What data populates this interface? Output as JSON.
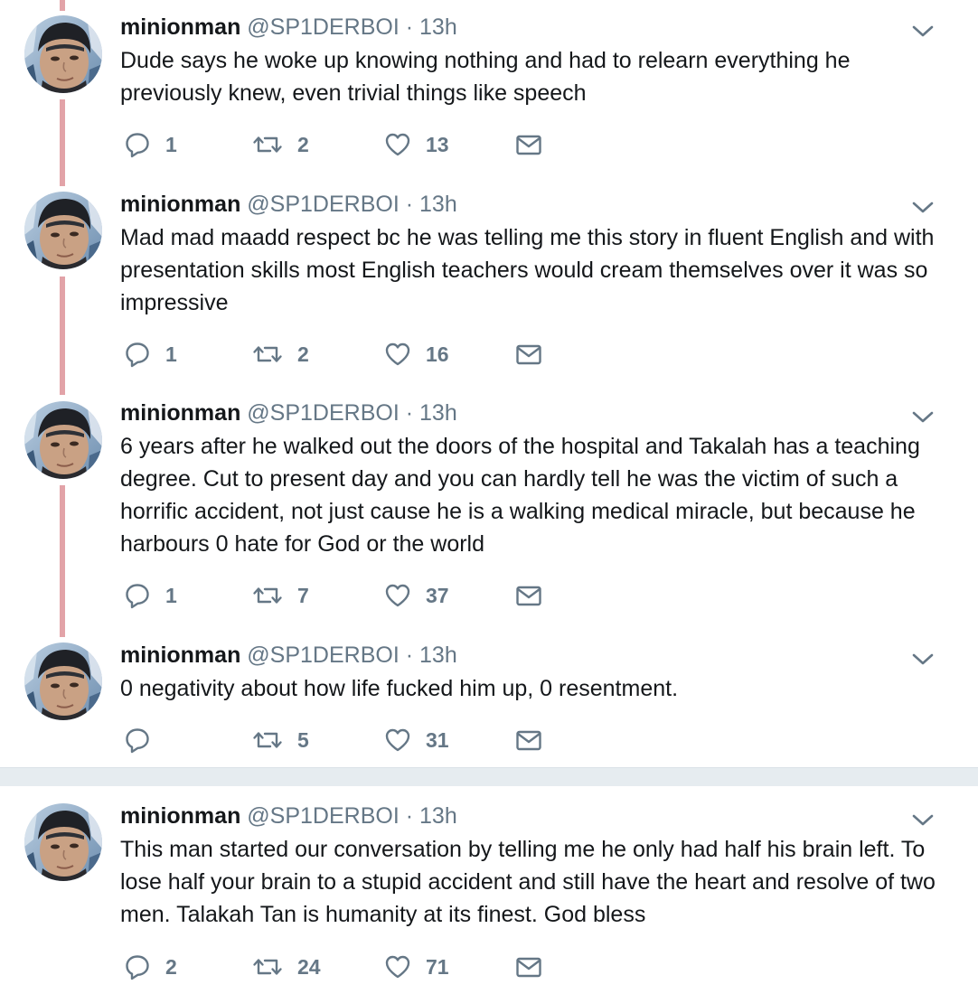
{
  "tweets": [
    {
      "name": "minionman",
      "handle": "@SP1DERBOI",
      "dot": "·",
      "time": "13h",
      "text": "Dude says he woke up knowing nothing and had to relearn everything he previously knew, even trivial things like speech",
      "replies": "1",
      "retweets": "2",
      "likes": "13"
    },
    {
      "name": "minionman",
      "handle": "@SP1DERBOI",
      "dot": "·",
      "time": "13h",
      "text": "Mad mad maadd respect bc he was telling me this story in fluent English and with presentation skills most English teachers would cream themselves over it was so impressive",
      "replies": "1",
      "retweets": "2",
      "likes": "16"
    },
    {
      "name": "minionman",
      "handle": "@SP1DERBOI",
      "dot": "·",
      "time": "13h",
      "text": "6 years after he walked out the doors of the hospital and Takalah has a teaching degree. Cut to present day and you can hardly tell he was the victim of such a horrific accident, not just cause he is a walking medical miracle, but because he harbours 0 hate for God or the world",
      "replies": "1",
      "retweets": "7",
      "likes": "37"
    },
    {
      "name": "minionman",
      "handle": "@SP1DERBOI",
      "dot": "·",
      "time": "13h",
      "text": "0 negativity about how life fucked him up, 0 resentment.",
      "replies": "",
      "retweets": "5",
      "likes": "31"
    },
    {
      "name": "minionman",
      "handle": "@SP1DERBOI",
      "dot": "·",
      "time": "13h",
      "text": "This man started our conversation by telling me he only had half his brain left. To lose half your brain to a stupid accident and still have the heart and resolve of two men. Talakah Tan is humanity at its finest. God bless",
      "replies": "2",
      "retweets": "24",
      "likes": "71"
    }
  ],
  "colors": {
    "thread_line": "#e2a3a8",
    "icon": "#657786",
    "separator": "#e6ecf0"
  },
  "icons": [
    "reply-icon",
    "retweet-icon",
    "like-icon",
    "direct-message-icon",
    "chevron-down-icon"
  ]
}
